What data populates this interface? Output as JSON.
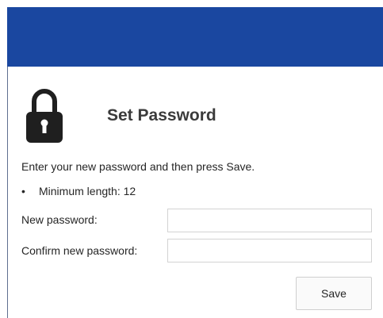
{
  "header": {
    "accent_color": "#1a47a0"
  },
  "dialog": {
    "icon": "lock-icon",
    "title": "Set Password",
    "instructions": "Enter your new password and then press Save.",
    "rules": [
      "Minimum length: 12"
    ],
    "fields": [
      {
        "label": "New password:",
        "value": "",
        "placeholder": ""
      },
      {
        "label": "Confirm new password:",
        "value": "",
        "placeholder": ""
      }
    ],
    "save_label": "Save"
  }
}
